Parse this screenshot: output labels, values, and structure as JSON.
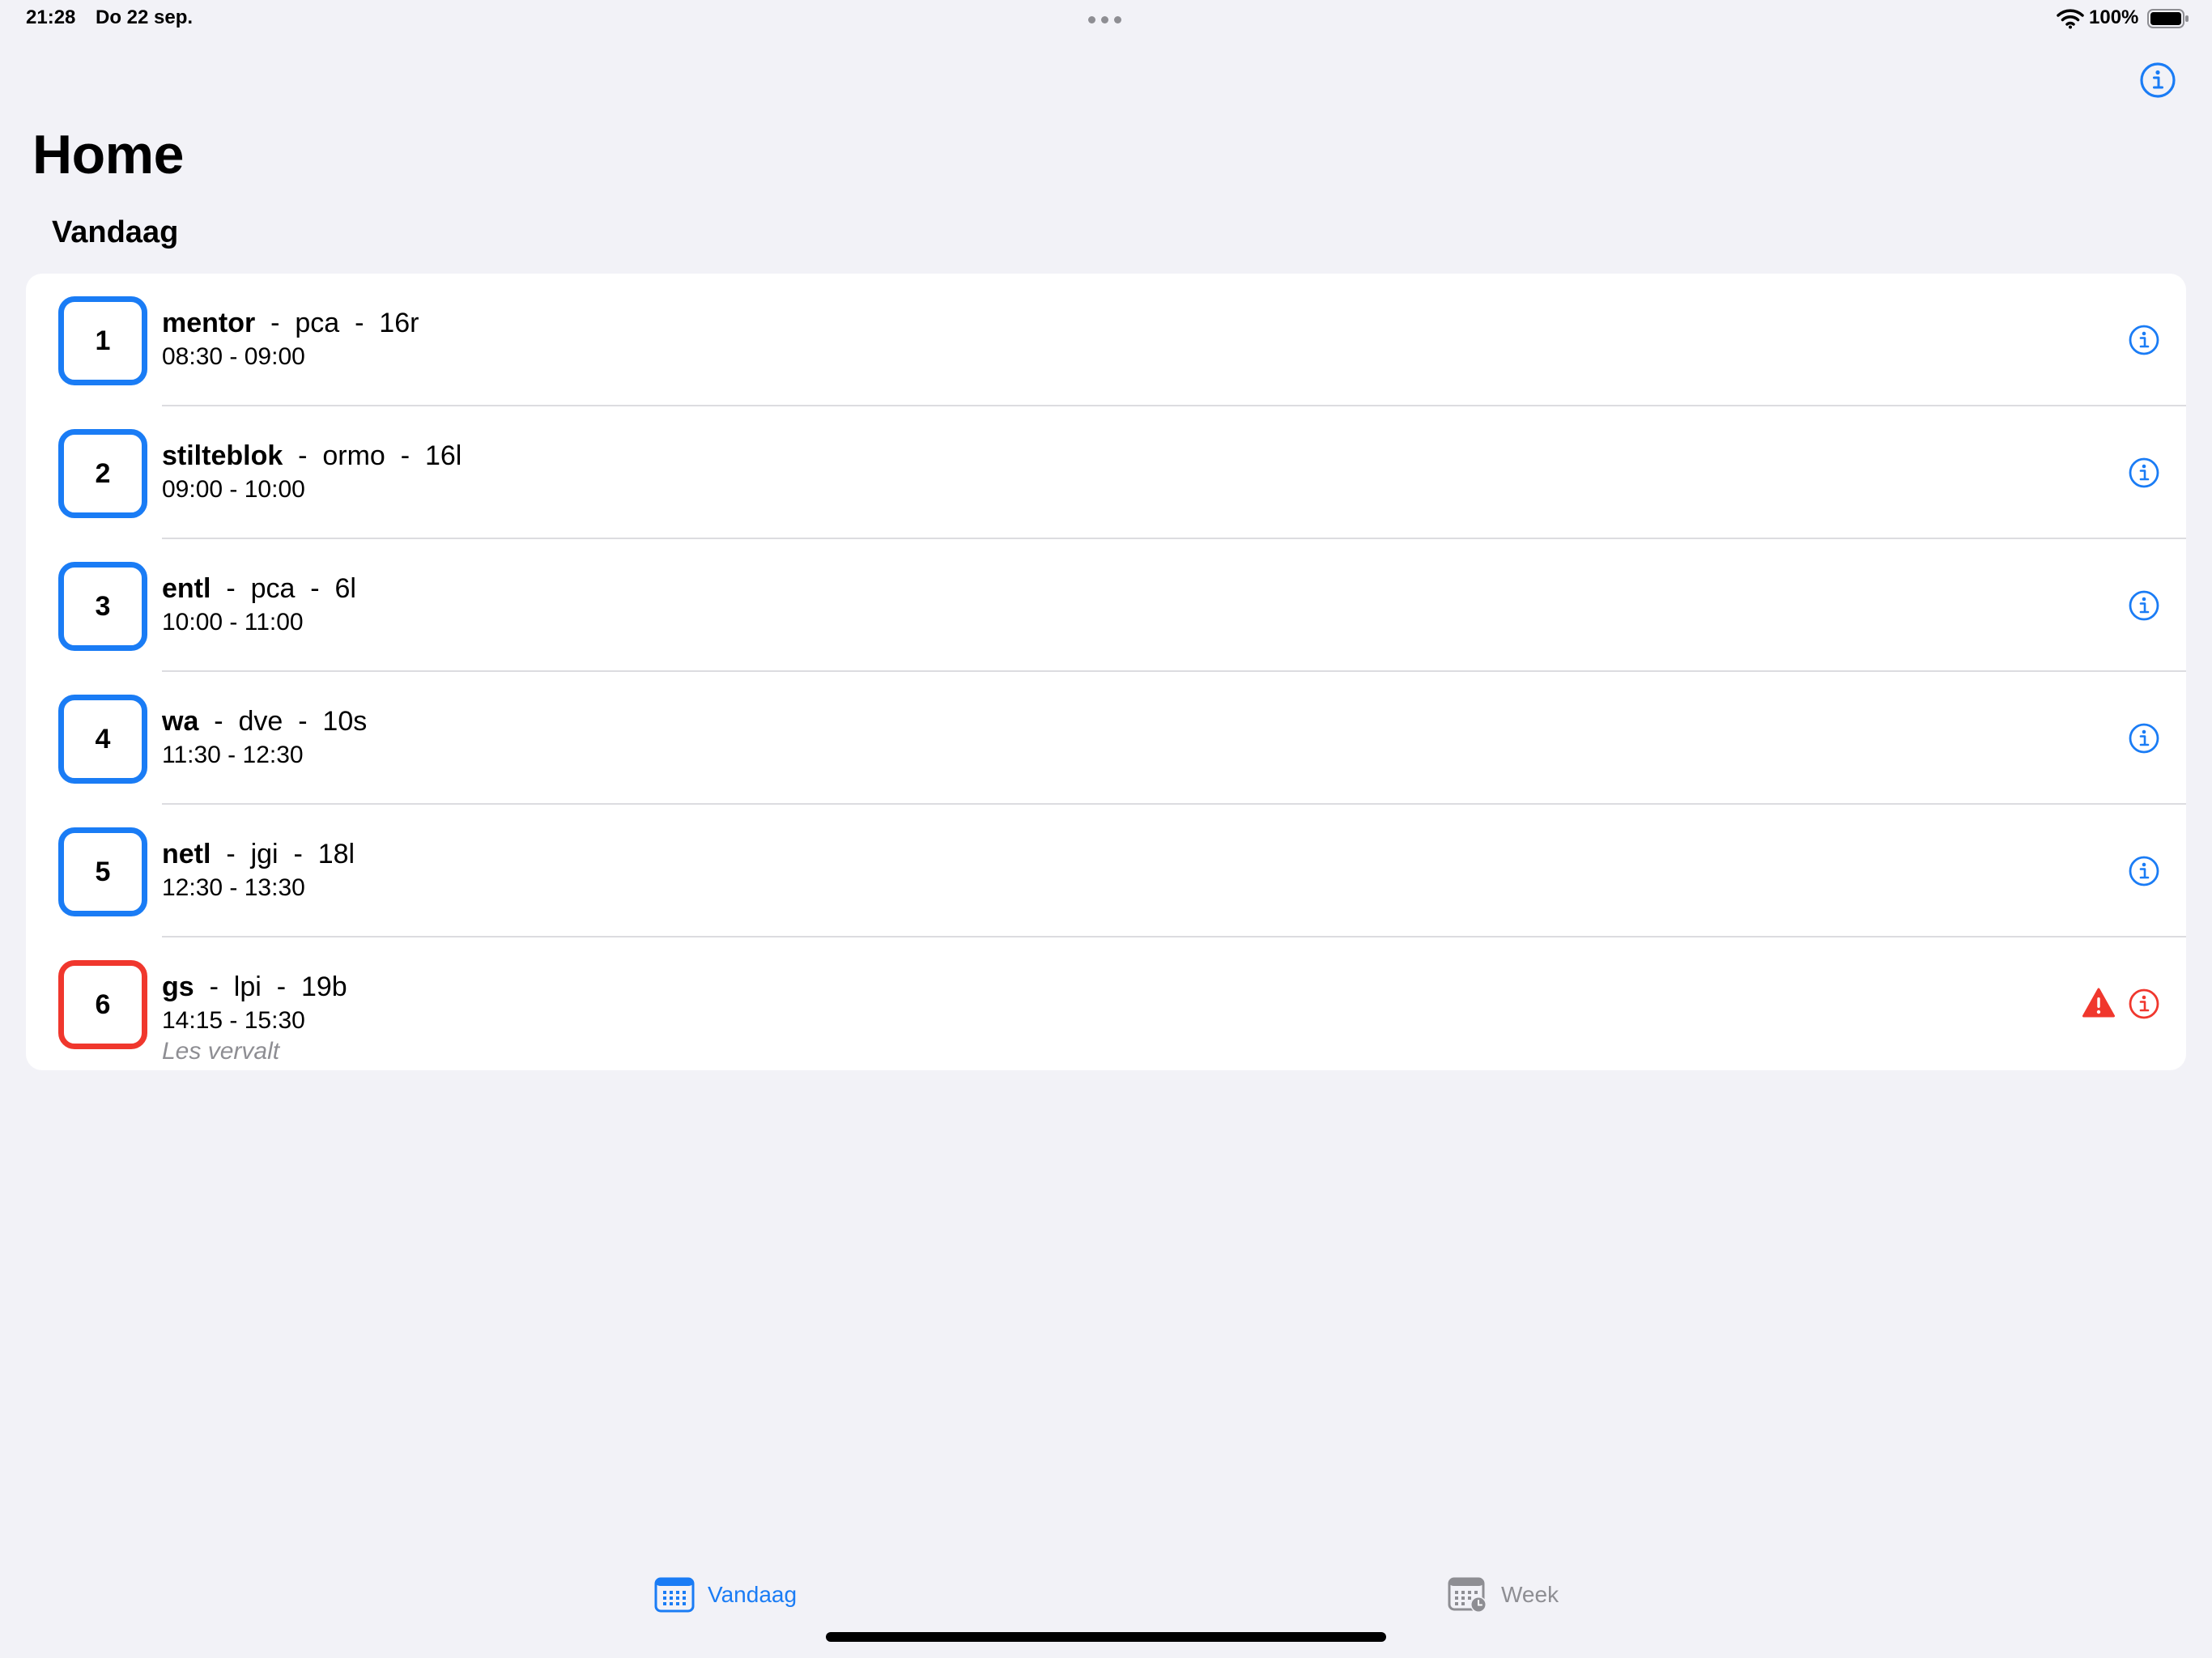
{
  "status_bar": {
    "time": "21:28",
    "date": "Do 22 sep.",
    "battery_percent": "100%"
  },
  "nav": {
    "title": "Home",
    "info_icon": "info-circle-icon"
  },
  "section": {
    "header": "Vandaag"
  },
  "lessons": [
    {
      "period": "1",
      "subject": "mentor",
      "teacher": "pca",
      "room": "16r",
      "time": "08:30 - 09:00",
      "note": "",
      "status": "normal"
    },
    {
      "period": "2",
      "subject": "stilteblok",
      "teacher": "ormo",
      "room": "16l",
      "time": "09:00 - 10:00",
      "note": "",
      "status": "normal"
    },
    {
      "period": "3",
      "subject": "entl",
      "teacher": "pca",
      "room": "6l",
      "time": "10:00 - 11:00",
      "note": "",
      "status": "normal"
    },
    {
      "period": "4",
      "subject": "wa",
      "teacher": "dve",
      "room": "10s",
      "time": "11:30 - 12:30",
      "note": "",
      "status": "normal"
    },
    {
      "period": "5",
      "subject": "netl",
      "teacher": "jgi",
      "room": "18l",
      "time": "12:30 - 13:30",
      "note": "",
      "status": "normal"
    },
    {
      "period": "6",
      "subject": "gs",
      "teacher": "lpi",
      "room": "19b",
      "time": "14:15 - 15:30",
      "note": "Les vervalt",
      "status": "cancelled"
    }
  ],
  "tab_bar": {
    "tabs": [
      {
        "label": "Vandaag",
        "icon": "calendar-icon",
        "selected": true
      },
      {
        "label": "Week",
        "icon": "calendar-clock-icon",
        "selected": false
      }
    ]
  },
  "colors": {
    "accent": "#1a7cf5",
    "cancelled": "#f0372d",
    "background": "#f2f2f7",
    "secondary_text": "#8e8e93"
  }
}
